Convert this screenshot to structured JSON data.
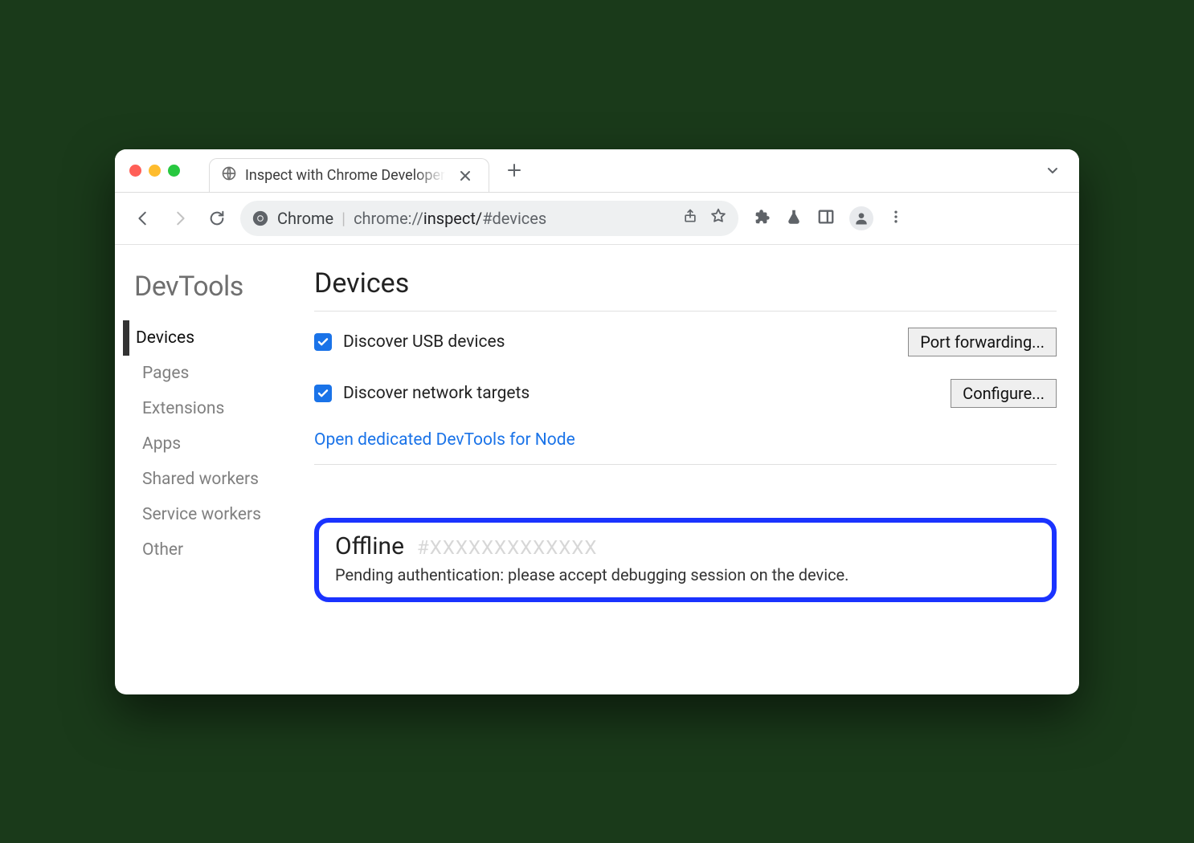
{
  "browser_tab": {
    "title": "Inspect with Chrome Developer"
  },
  "omnibox": {
    "label": "Chrome",
    "url_prefix": "chrome://",
    "url_path": "inspect/",
    "url_hash": "#devices"
  },
  "sidebar": {
    "title": "DevTools",
    "items": [
      {
        "label": "Devices",
        "active": true
      },
      {
        "label": "Pages"
      },
      {
        "label": "Extensions"
      },
      {
        "label": "Apps"
      },
      {
        "label": "Shared workers"
      },
      {
        "label": "Service workers"
      },
      {
        "label": "Other"
      }
    ]
  },
  "main": {
    "heading": "Devices",
    "discover_usb": {
      "label": "Discover USB devices",
      "button": "Port forwarding..."
    },
    "discover_network": {
      "label": "Discover network targets",
      "button": "Configure..."
    },
    "node_link": "Open dedicated DevTools for Node",
    "offline": {
      "title": "Offline",
      "hash": "#XXXXXXXXXXXXX",
      "message": "Pending authentication: please accept debugging session on the device."
    }
  }
}
